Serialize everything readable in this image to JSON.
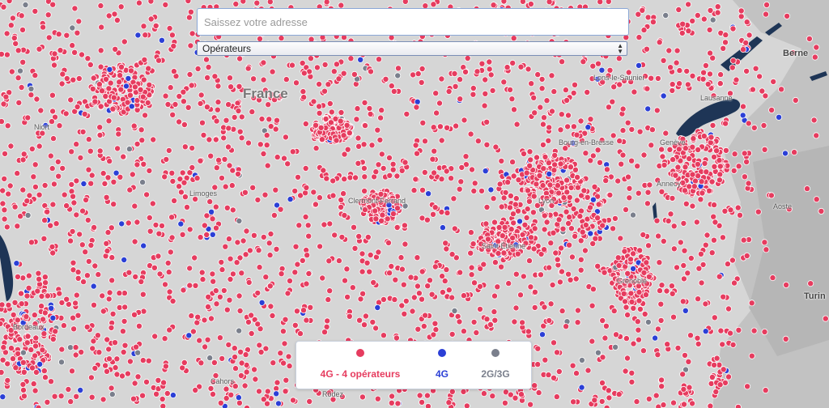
{
  "search": {
    "placeholder": "Saissez votre adresse",
    "value": ""
  },
  "operators_select": {
    "selected": "Opérateurs"
  },
  "legend": [
    {
      "label": "4G - 4 opérateurs",
      "color": "#e63c5f"
    },
    {
      "label": "4G",
      "color": "#2b3fd6"
    },
    {
      "label": "2G/3G",
      "color": "#7a7f8c"
    }
  ],
  "places": {
    "france": "France",
    "niort": "Niort",
    "limoges": "Limoges",
    "bordeaux": "Bordeaux",
    "cahors": "Cahors",
    "rodez": "Rodez",
    "clermont": "Clermont-Ferrand",
    "lyon": "Lyon",
    "saint_etienne": "Saint-Étienne",
    "grenoble": "Grenoble",
    "bourg": "Bourg-en-Bresse",
    "lons": "Lons-le-Saunier",
    "lausanne": "Lausanne",
    "geneve": "Genève",
    "annecy": "Annecy",
    "aoste": "Aoste",
    "berne": "Berne",
    "turin": "Turin"
  },
  "colors": {
    "land": "#d6d6d6",
    "relief": "#bdbdbd",
    "water": "#1e3556",
    "site_4g_4op": "#e63c5f",
    "site_4g": "#2b3fd6",
    "site_2g3g": "#7a7f8c"
  }
}
